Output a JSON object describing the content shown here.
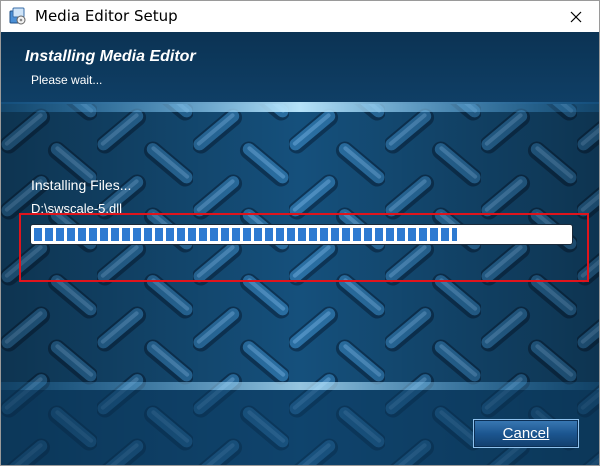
{
  "window": {
    "title": "Media Editor Setup",
    "icon": "setup-app-icon",
    "close_icon": "close-icon"
  },
  "header": {
    "title": "Installing Media Editor",
    "subtitle": "Please wait..."
  },
  "progress": {
    "status": "Installing Files...",
    "current_file": "D:\\swscale-5.dll",
    "fraction": 0.79
  },
  "buttons": {
    "cancel_label": "Cancel"
  },
  "colors": {
    "background": "#12466c",
    "progress_fill": "#2e7ad1",
    "highlight_box": "#e0141c",
    "glow": "#9fd8ff"
  }
}
